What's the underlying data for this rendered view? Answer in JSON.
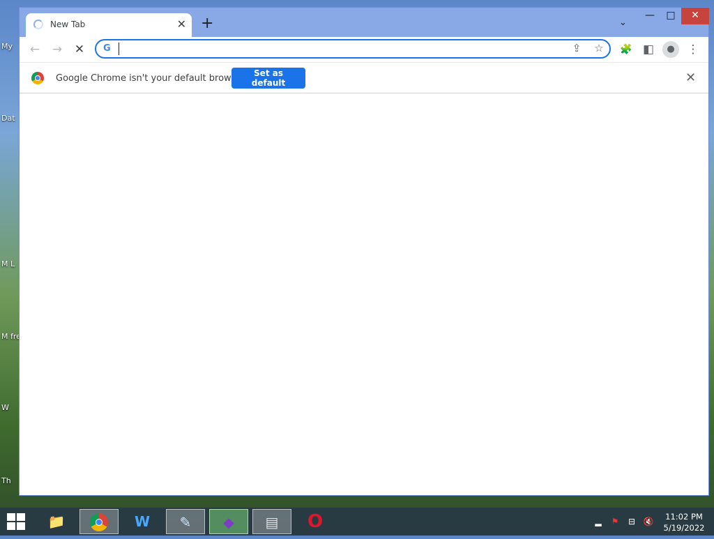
{
  "desktop": {
    "icon_labels": [
      "My",
      "Dat",
      "M L",
      "M free",
      "W",
      "Th"
    ]
  },
  "browser": {
    "tab": {
      "title": "New Tab",
      "close_label": "✕"
    },
    "new_tab_label": "+",
    "tab_search_label": "⌄",
    "window_controls": {
      "minimize": "—",
      "maximize": "□",
      "close": "✕"
    },
    "toolbar": {
      "back_label": "←",
      "forward_label": "→",
      "stop_label": "✕",
      "omnibox_value": "",
      "share_label": "⇪",
      "bookmark_label": "☆",
      "extensions_label": "🧩",
      "side_panel_label": "◧",
      "profile_label": "●",
      "menu_label": "⋮"
    },
    "infobar": {
      "message": "Google Chrome isn't your default browser",
      "set_default_label": "Set as default",
      "close_label": "✕"
    }
  },
  "taskbar": {
    "apps": [
      {
        "name": "file-explorer-icon",
        "glyph": "📁"
      },
      {
        "name": "chrome-icon",
        "glyph": ""
      },
      {
        "name": "wing-ide-icon",
        "glyph": "W"
      },
      {
        "name": "notepad-icon",
        "glyph": "✎"
      },
      {
        "name": "visual-studio-installer-icon",
        "glyph": "◆"
      },
      {
        "name": "task-manager-icon",
        "glyph": "▤"
      },
      {
        "name": "opera-icon",
        "glyph": "O"
      }
    ],
    "clock": {
      "time": "11:02 PM",
      "date": "5/19/2022"
    }
  }
}
